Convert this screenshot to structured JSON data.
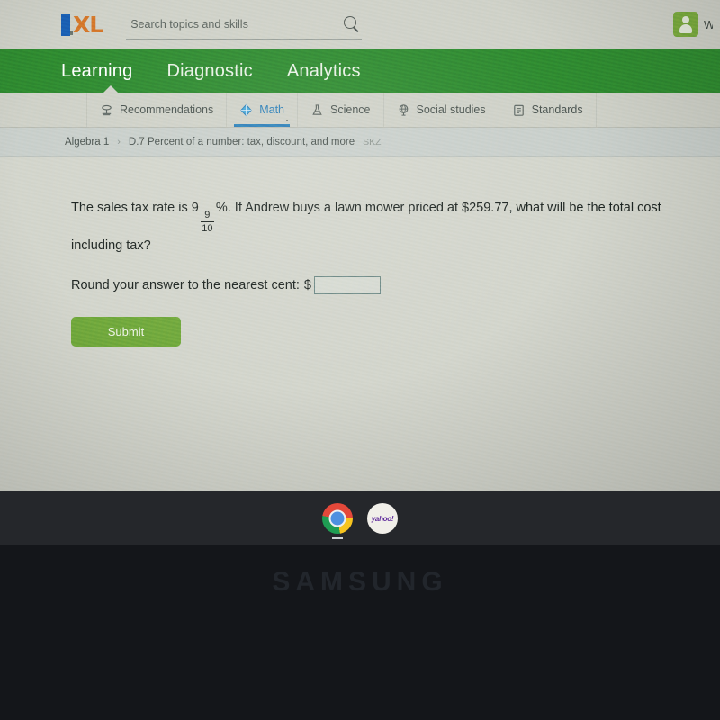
{
  "device": {
    "brand_watermark": "SAMSUNG"
  },
  "header": {
    "logo_i": "I",
    "logo_xl": "XL",
    "search": {
      "placeholder": "Search topics and skills",
      "value": "",
      "icon": "search-icon"
    },
    "account": {
      "avatar_icon": "user-avatar-icon",
      "name": "W"
    }
  },
  "primary_nav": {
    "items": [
      {
        "label": "Learning",
        "active": true
      },
      {
        "label": "Diagnostic",
        "active": false
      },
      {
        "label": "Analytics",
        "active": false
      }
    ],
    "bar_color": "#2f8a30"
  },
  "subject_tabs": [
    {
      "label": "Recommendations",
      "icon": "recommendations-icon",
      "active": false
    },
    {
      "label": "Math",
      "icon": "math-icon",
      "active": true
    },
    {
      "label": "Science",
      "icon": "science-flask-icon",
      "active": false
    },
    {
      "label": "Social studies",
      "icon": "globe-icon",
      "active": false
    },
    {
      "label": "Standards",
      "icon": "clipboard-icon",
      "active": false
    }
  ],
  "breadcrumb": {
    "course": "Algebra 1",
    "separator": "›",
    "skill": "D.7 Percent of a number: tax, discount, and more",
    "code": "SKZ"
  },
  "question": {
    "part1": "The sales tax rate is 9",
    "fraction_numerator": "9",
    "fraction_denominator": "10",
    "part2": "%. If Andrew buys a lawn mower priced at $259.77, what will be the total cost including tax?",
    "instruction": "Round your answer to the nearest cent:",
    "currency_symbol": "$",
    "answer_value": "",
    "answer_placeholder": ""
  },
  "actions": {
    "submit_label": "Submit",
    "submit_color": "#70a83c"
  },
  "taskbar": {
    "items": [
      {
        "label": "Chrome",
        "icon": "chrome-icon",
        "running": true
      },
      {
        "label": "yahoo!",
        "icon": "yahoo-icon",
        "running": false
      }
    ]
  }
}
